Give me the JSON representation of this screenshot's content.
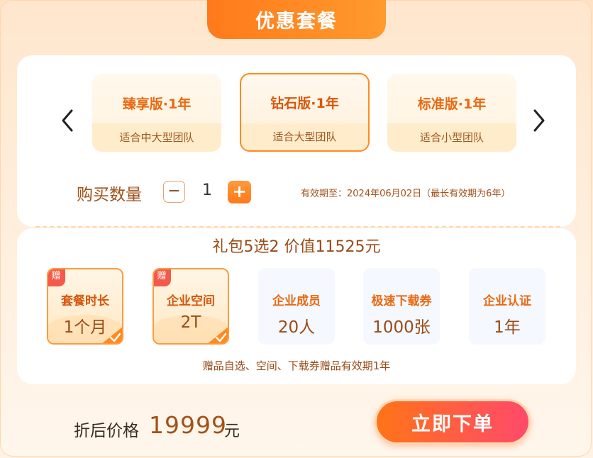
{
  "header": {
    "title": "优惠套餐"
  },
  "plans": [
    {
      "name": "臻享版·1年",
      "desc": "适合中大型团队",
      "selected": false
    },
    {
      "name": "钻石版·1年",
      "desc": "适合大型团队",
      "selected": true
    },
    {
      "name": "标准版·1年",
      "desc": "适合小型团队",
      "selected": false
    }
  ],
  "nav": {
    "prev_icon": "chevron-left-icon",
    "next_icon": "chevron-right-icon"
  },
  "quantity": {
    "label": "购买数量",
    "minus": "−",
    "value": "1",
    "plus": "+",
    "validity": "有效期至：2024年06月02日（最长有效期为6年）"
  },
  "gifts": {
    "title": "礼包5选2 价值11525元",
    "badge": "赠",
    "items": [
      {
        "name": "套餐时长",
        "value": "1个月",
        "chosen": true
      },
      {
        "name": "企业空间",
        "value": "2T",
        "chosen": true
      },
      {
        "name": "企业成员",
        "value": "20人",
        "chosen": false
      },
      {
        "name": "极速下载券",
        "value": "1000张",
        "chosen": false
      },
      {
        "name": "企业认证",
        "value": "1年",
        "chosen": false
      }
    ],
    "note": "赠品自选、空间、下载券赠品有效期1年"
  },
  "footer": {
    "price_label": "折后价格",
    "price": "19999",
    "unit": "元",
    "order_button": "立即下单"
  },
  "colors": {
    "accent": "#ff7a1a",
    "text_brown": "#9a4a17",
    "button_end": "#ff4a6a"
  }
}
